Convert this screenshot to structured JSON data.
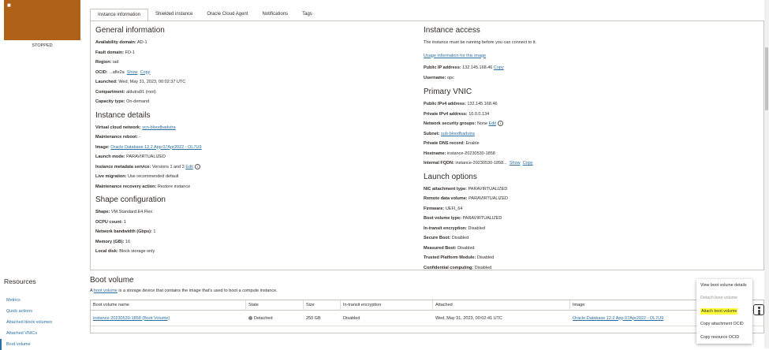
{
  "left": {
    "state": "STOPPED",
    "resources_title": "Resources",
    "resources": [
      "Metrics",
      "Quick actions",
      "Attached block volumes",
      "Attached VNICs",
      "Boot volume"
    ]
  },
  "tabs": [
    "Instance information",
    "Shielded instance",
    "Oracle Cloud Agent",
    "Notifications",
    "Tags"
  ],
  "general": {
    "title": "General information",
    "availability_domain": {
      "label": "Availability domain:",
      "value": "AD-1"
    },
    "fault_domain": {
      "label": "Fault domain:",
      "value": "FD-1"
    },
    "region": {
      "label": "Region:",
      "value": "iad"
    },
    "ocid": {
      "label": "OCID:",
      "value": "...afle2a",
      "show": "Show",
      "copy": "Copy"
    },
    "launched": {
      "label": "Launched:",
      "value": "Wed, May 31, 2023, 00:02:37 UTC"
    },
    "compartment": {
      "label": "Compartment:",
      "value": "aldutra91 (root)"
    },
    "capacity": {
      "label": "Capacity type:",
      "value": "On-demand"
    }
  },
  "details": {
    "title": "Instance details",
    "vcn": {
      "label": "Virtual cloud network:",
      "value": "vcn-bloodbadutra"
    },
    "maintenance_reboot": {
      "label": "Maintenance reboot:",
      "value": "-"
    },
    "image": {
      "label": "Image:",
      "value": "Oracle Database 12.2 App 07Apr2022 - OL7U9"
    },
    "launch_mode": {
      "label": "Launch mode:",
      "value": "PARAVIRTUALIZED"
    },
    "metadata": {
      "label": "Instance metadata service:",
      "value": "Versions 1 and 2",
      "edit": "Edit"
    },
    "live_migration": {
      "label": "Live migration:",
      "value": "Use recommended default"
    },
    "recovery": {
      "label": "Maintenance recovery action:",
      "value": "Restore instance"
    }
  },
  "shape": {
    "title": "Shape configuration",
    "shape": {
      "label": "Shape:",
      "value": "VM.Standard.E4.Flex"
    },
    "ocpu": {
      "label": "OCPU count:",
      "value": "1"
    },
    "bandwidth": {
      "label": "Network bandwidth (Gbps):",
      "value": "1"
    },
    "memory": {
      "label": "Memory (GB):",
      "value": "16"
    },
    "local_disk": {
      "label": "Local disk:",
      "value": "Block storage only"
    }
  },
  "access": {
    "title": "Instance access",
    "note": "The instance must be running before you can connect to it.",
    "usage_link": "Usage information for this image",
    "public_ip": {
      "label": "Public IP address:",
      "value": "132.145.168.46",
      "copy": "Copy"
    },
    "username": {
      "label": "Username:",
      "value": "opc"
    }
  },
  "vnic": {
    "title": "Primary VNIC",
    "public_ipv4": {
      "label": "Public IPv4 address:",
      "value": "132.145.168.46"
    },
    "private_ipv4": {
      "label": "Private IPv4 address:",
      "value": "10.0.0.134"
    },
    "nsg": {
      "label": "Network security groups:",
      "value": "None",
      "edit": "Edit"
    },
    "subnet": {
      "label": "Subnet:",
      "value": "sub-bloodbadutra"
    },
    "private_dns": {
      "label": "Private DNS record:",
      "value": "Enable"
    },
    "hostname": {
      "label": "Hostname:",
      "value": "instance-20230530-1858"
    },
    "fqdn": {
      "label": "Internal FQDN:",
      "value": "instance-20230530-1858...",
      "show": "Show",
      "copy": "Copy"
    }
  },
  "launch": {
    "title": "Launch options",
    "nic": {
      "label": "NIC attachment type:",
      "value": "PARAVIRTUALIZED"
    },
    "remote": {
      "label": "Remote data volume:",
      "value": "PARAVIRTUALIZED"
    },
    "firmware": {
      "label": "Firmware:",
      "value": "UEFI_64"
    },
    "boot_type": {
      "label": "Boot volume type:",
      "value": "PARAVIRTUALIZED"
    },
    "in_transit": {
      "label": "In-transit encryption:",
      "value": "Disabled"
    },
    "secure_boot": {
      "label": "Secure Boot:",
      "value": "Disabled"
    },
    "measured_boot": {
      "label": "Measured Boot:",
      "value": "Disabled"
    },
    "tpm": {
      "label": "Trusted Platform Module:",
      "value": "Disabled"
    },
    "confidential": {
      "label": "Confidential computing:",
      "value": "Disabled"
    }
  },
  "boot_volume": {
    "title": "Boot volume",
    "desc_prefix": "A",
    "desc_link": "boot volume",
    "desc_suffix": "is a storage device that contains the image that's used to boot a compute instance.",
    "columns": [
      "Boot volume name",
      "State",
      "Size",
      "In-transit encryption",
      "Attached",
      "Image"
    ],
    "row": {
      "name": "instance-20230530-1858 (Boot Volume)",
      "state": "Detached",
      "size": "250 GB",
      "encryption": "Disabled",
      "attached": "Wed, May 31, 2023, 00:02:41 UTC",
      "image": "Oracle Database 12.2 App 07Apr2022 - OL7U9"
    }
  },
  "menu": {
    "items": [
      "View boot volume details",
      "Detach boot volume",
      "Attach boot volume",
      "Copy attachment OCID",
      "Copy resource OCID"
    ],
    "highlight_color": "#ffff3c"
  }
}
